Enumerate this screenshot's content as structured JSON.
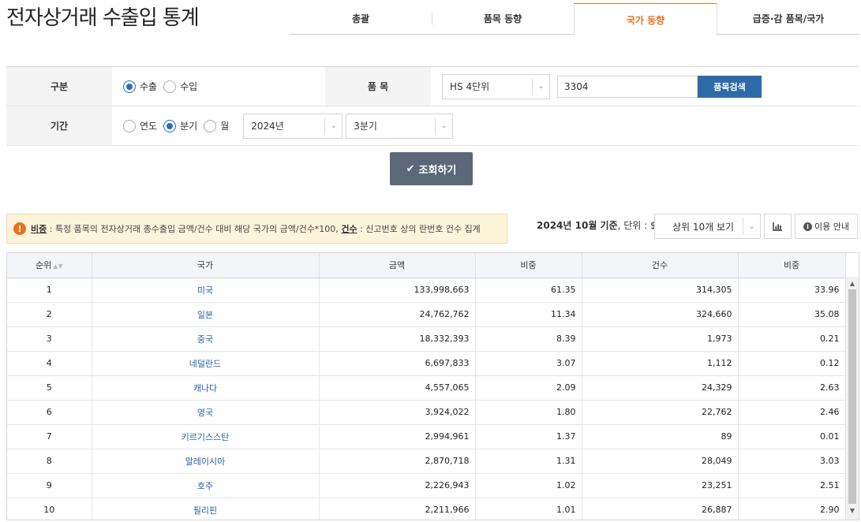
{
  "title": "전자상거래 수출입 통계",
  "tabs": [
    {
      "label": "총괄",
      "active": false
    },
    {
      "label": "품목 동향",
      "active": false
    },
    {
      "label": "국가 동향",
      "active": true
    },
    {
      "label": "급증·감 품목/국가",
      "active": false
    }
  ],
  "filter": {
    "type_label": "구분",
    "type_options": [
      {
        "label": "수출",
        "checked": true
      },
      {
        "label": "수입",
        "checked": false
      }
    ],
    "item_label": "품 목",
    "hs_select": "HS 4단위",
    "item_value": "3304",
    "item_search_button": "품목검색",
    "period_label": "기간",
    "period_options": [
      {
        "label": "연도",
        "checked": false
      },
      {
        "label": "분기",
        "checked": true
      },
      {
        "label": "월",
        "checked": false
      }
    ],
    "year_select": "2024년",
    "quarter_select": "3분기"
  },
  "search_button": "조회하기",
  "notice": {
    "term1": "비중",
    "text1": " : 특정 품목의 전자상거래 총수출입 금액/건수 대비 해당 국가의 금액/건수*100, ",
    "term2": "건수",
    "text2": " : 신고번호 상의 란번호 건수 집계"
  },
  "basis": {
    "date": "2024년 10월 기준",
    "unit": ", 단위 : $"
  },
  "topn_select": "상위 10개 보기",
  "guide_button": "이용 안내",
  "colors": {
    "accent": "#e8731f",
    "primary": "#2f6aa8",
    "link": "#2a62a6"
  },
  "table": {
    "headers": [
      "순위",
      "국가",
      "금액",
      "비중",
      "건수",
      "비중"
    ],
    "rows": [
      [
        "1",
        "미국",
        "133,998,663",
        "61.35",
        "314,305",
        "33.96"
      ],
      [
        "2",
        "일본",
        "24,762,762",
        "11.34",
        "324,660",
        "35.08"
      ],
      [
        "3",
        "중국",
        "18,332,393",
        "8.39",
        "1,973",
        "0.21"
      ],
      [
        "4",
        "네덜란드",
        "6,697,833",
        "3.07",
        "1,112",
        "0.12"
      ],
      [
        "5",
        "캐나다",
        "4,557,065",
        "2.09",
        "24,329",
        "2.63"
      ],
      [
        "6",
        "영국",
        "3,924,022",
        "1.80",
        "22,762",
        "2.46"
      ],
      [
        "7",
        "키르기스스탄",
        "2,994,961",
        "1.37",
        "89",
        "0.01"
      ],
      [
        "8",
        "말레이시아",
        "2,870,718",
        "1.31",
        "28,049",
        "3.03"
      ],
      [
        "9",
        "호주",
        "2,226,943",
        "1.02",
        "23,251",
        "2.51"
      ],
      [
        "10",
        "필리핀",
        "2,211,966",
        "1.01",
        "26,887",
        "2.90"
      ]
    ]
  }
}
